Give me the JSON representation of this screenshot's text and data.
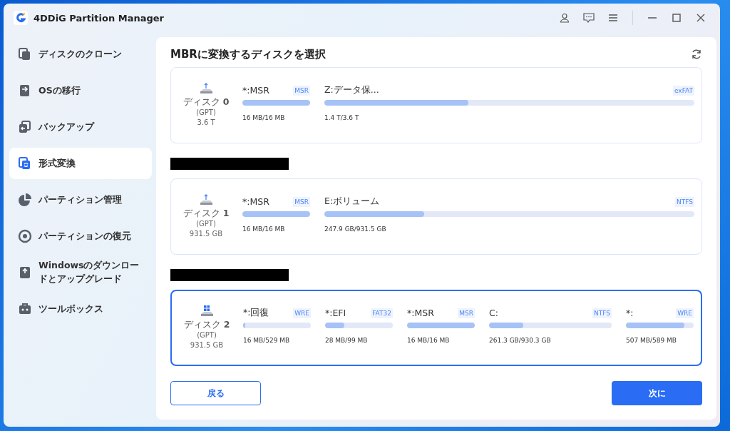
{
  "window": {
    "title": "4DDiG Partition Manager"
  },
  "sidebar": {
    "items": [
      {
        "label": "ディスクのクローン",
        "selected": false
      },
      {
        "label": "OSの移行",
        "selected": false
      },
      {
        "label": "バックアップ",
        "selected": false
      },
      {
        "label": "形式変換",
        "selected": true
      },
      {
        "label": "パーティション管理",
        "selected": false
      },
      {
        "label": "パーティションの復元",
        "selected": false
      },
      {
        "label": "Windowsのダウンロードとアップグレード",
        "selected": false
      },
      {
        "label": "ツールボックス",
        "selected": false
      }
    ]
  },
  "main": {
    "title": "MBRに変換するディスクを選択",
    "disks": [
      {
        "name": "ディスク **0**",
        "style": "(GPT)",
        "size": "3.6 T",
        "selected": false,
        "kind": "usb",
        "redacted": false,
        "partitions": [
          {
            "name": "*:MSR",
            "fs": "MSR",
            "usage": "16 MB/16 MB",
            "level": 1,
            "kind": "narrow"
          },
          {
            "name": "Z:データ保...",
            "fs": "exFAT",
            "usage": "1.4 T/3.6 T",
            "level": 0.39,
            "kind": "wide"
          }
        ]
      },
      {
        "name": "ディスク **1**",
        "style": "(GPT)",
        "size": "931.5 GB",
        "selected": false,
        "kind": "usb",
        "redacted": true,
        "partitions": [
          {
            "name": "*:MSR",
            "fs": "MSR",
            "usage": "16 MB/16 MB",
            "level": 1,
            "kind": "narrow"
          },
          {
            "name": "E:ボリューム",
            "fs": "NTFS",
            "usage": "247.9 GB/931.5 GB",
            "level": 0.27,
            "kind": "wide"
          }
        ]
      },
      {
        "name": "ディスク **2**",
        "style": "(GPT)",
        "size": "931.5 GB",
        "selected": true,
        "kind": "system",
        "redacted": true,
        "partitions": [
          {
            "name": "*:回復",
            "fs": "WRE",
            "usage": "16 MB/529 MB",
            "level": 0.03,
            "kind": "narrow"
          },
          {
            "name": "*:EFI",
            "fs": "FAT32",
            "usage": "28 MB/99 MB",
            "level": 0.28,
            "kind": "narrow"
          },
          {
            "name": "*:MSR",
            "fs": "MSR",
            "usage": "16 MB/16 MB",
            "level": 1,
            "kind": "narrow"
          },
          {
            "name": "C:",
            "fs": "NTFS",
            "usage": "261.3 GB/930.3 GB",
            "level": 0.28,
            "kind": "wide"
          },
          {
            "name": "*:",
            "fs": "WRE",
            "usage": "507 MB/589 MB",
            "level": 0.86,
            "kind": "narrow"
          }
        ]
      }
    ]
  },
  "buttons": {
    "back": "戻る",
    "next": "次に"
  }
}
